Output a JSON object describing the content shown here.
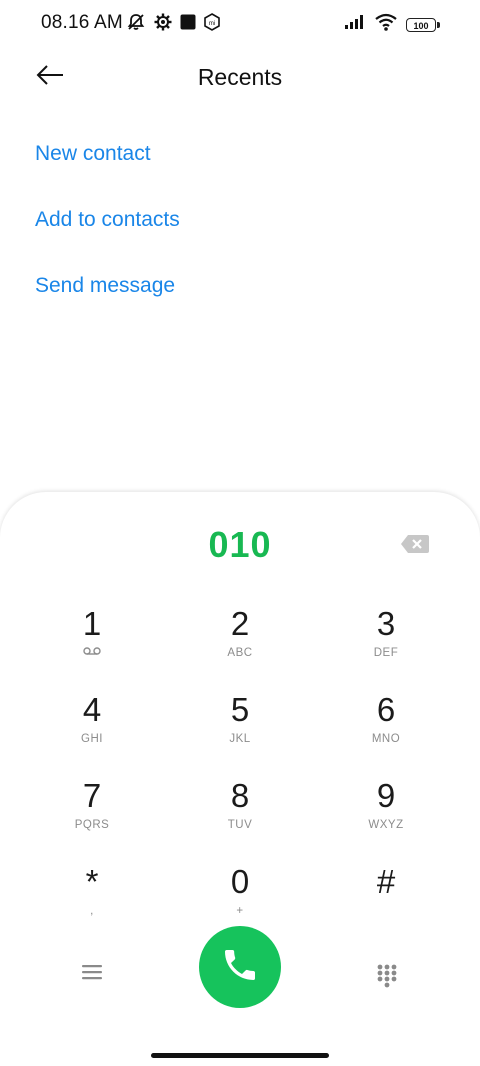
{
  "status_bar": {
    "time": "08.16 AM",
    "battery": "100",
    "icons": [
      "mute-vibrate-icon",
      "settings-gear-icon",
      "square-app-icon",
      "mi-icon",
      "signal-icon",
      "wifi-icon",
      "battery-icon"
    ]
  },
  "header": {
    "title": "Recents",
    "back_icon": "back-arrow-icon"
  },
  "actions": [
    {
      "label": "New contact"
    },
    {
      "label": "Add to contacts"
    },
    {
      "label": "Send message"
    }
  ],
  "dialer": {
    "number": "010",
    "keys": [
      {
        "digit": "1",
        "sub": ""
      },
      {
        "digit": "2",
        "sub": "ABC"
      },
      {
        "digit": "3",
        "sub": "DEF"
      },
      {
        "digit": "4",
        "sub": "GHI"
      },
      {
        "digit": "5",
        "sub": "JKL"
      },
      {
        "digit": "6",
        "sub": "MNO"
      },
      {
        "digit": "7",
        "sub": "PQRS"
      },
      {
        "digit": "8",
        "sub": "TUV"
      },
      {
        "digit": "9",
        "sub": "WXYZ"
      },
      {
        "digit": "*",
        "sub": ","
      },
      {
        "digit": "0",
        "sub": "+"
      },
      {
        "digit": "#",
        "sub": ""
      }
    ],
    "call_color": "#16c35c",
    "number_color": "#18b852",
    "link_color": "#1a86e8"
  }
}
